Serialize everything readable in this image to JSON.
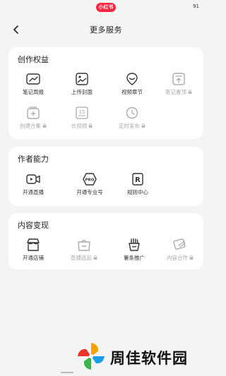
{
  "status_bar": {
    "app_badge": "小红书",
    "battery": "91"
  },
  "header": {
    "title": "更多服务",
    "back_icon": "chevron-left-icon"
  },
  "sections": [
    {
      "title": "创作权益",
      "items": [
        {
          "label": "笔记周报",
          "icon": "chart-icon",
          "enabled": true
        },
        {
          "label": "上传封面",
          "icon": "image-icon",
          "enabled": true
        },
        {
          "label": "视频章节",
          "icon": "location-pin-icon",
          "enabled": true
        },
        {
          "label": "笔记置顶",
          "icon": "pin-top-icon",
          "enabled": false
        },
        {
          "label": "创建合集",
          "icon": "add-collection-icon",
          "enabled": false
        },
        {
          "label": "长视频",
          "icon": "long-video-icon",
          "enabled": false,
          "icon_text": "15"
        },
        {
          "label": "定时发布",
          "icon": "clock-icon",
          "enabled": false
        }
      ]
    },
    {
      "title": "作者能力",
      "items": [
        {
          "label": "开通直播",
          "icon": "live-video-icon",
          "enabled": true
        },
        {
          "label": "开通专业号",
          "icon": "pro-badge-icon",
          "enabled": true,
          "icon_text": "PRO"
        },
        {
          "label": "规则中心",
          "icon": "rules-icon",
          "enabled": true,
          "icon_text": "R"
        }
      ]
    },
    {
      "title": "内容变现",
      "items": [
        {
          "label": "开通店铺",
          "icon": "store-icon",
          "enabled": true
        },
        {
          "label": "直播选品",
          "icon": "shopping-bag-icon",
          "enabled": false
        },
        {
          "label": "薯条推广",
          "icon": "fries-icon",
          "enabled": true
        },
        {
          "label": "内容合作",
          "icon": "cooperation-icon",
          "enabled": false
        }
      ]
    }
  ],
  "watermark": {
    "text": "周佳软件园"
  },
  "colors": {
    "brand": "#ff2442",
    "background": "#f4f4f5",
    "disabled": "#aaaaaa"
  }
}
